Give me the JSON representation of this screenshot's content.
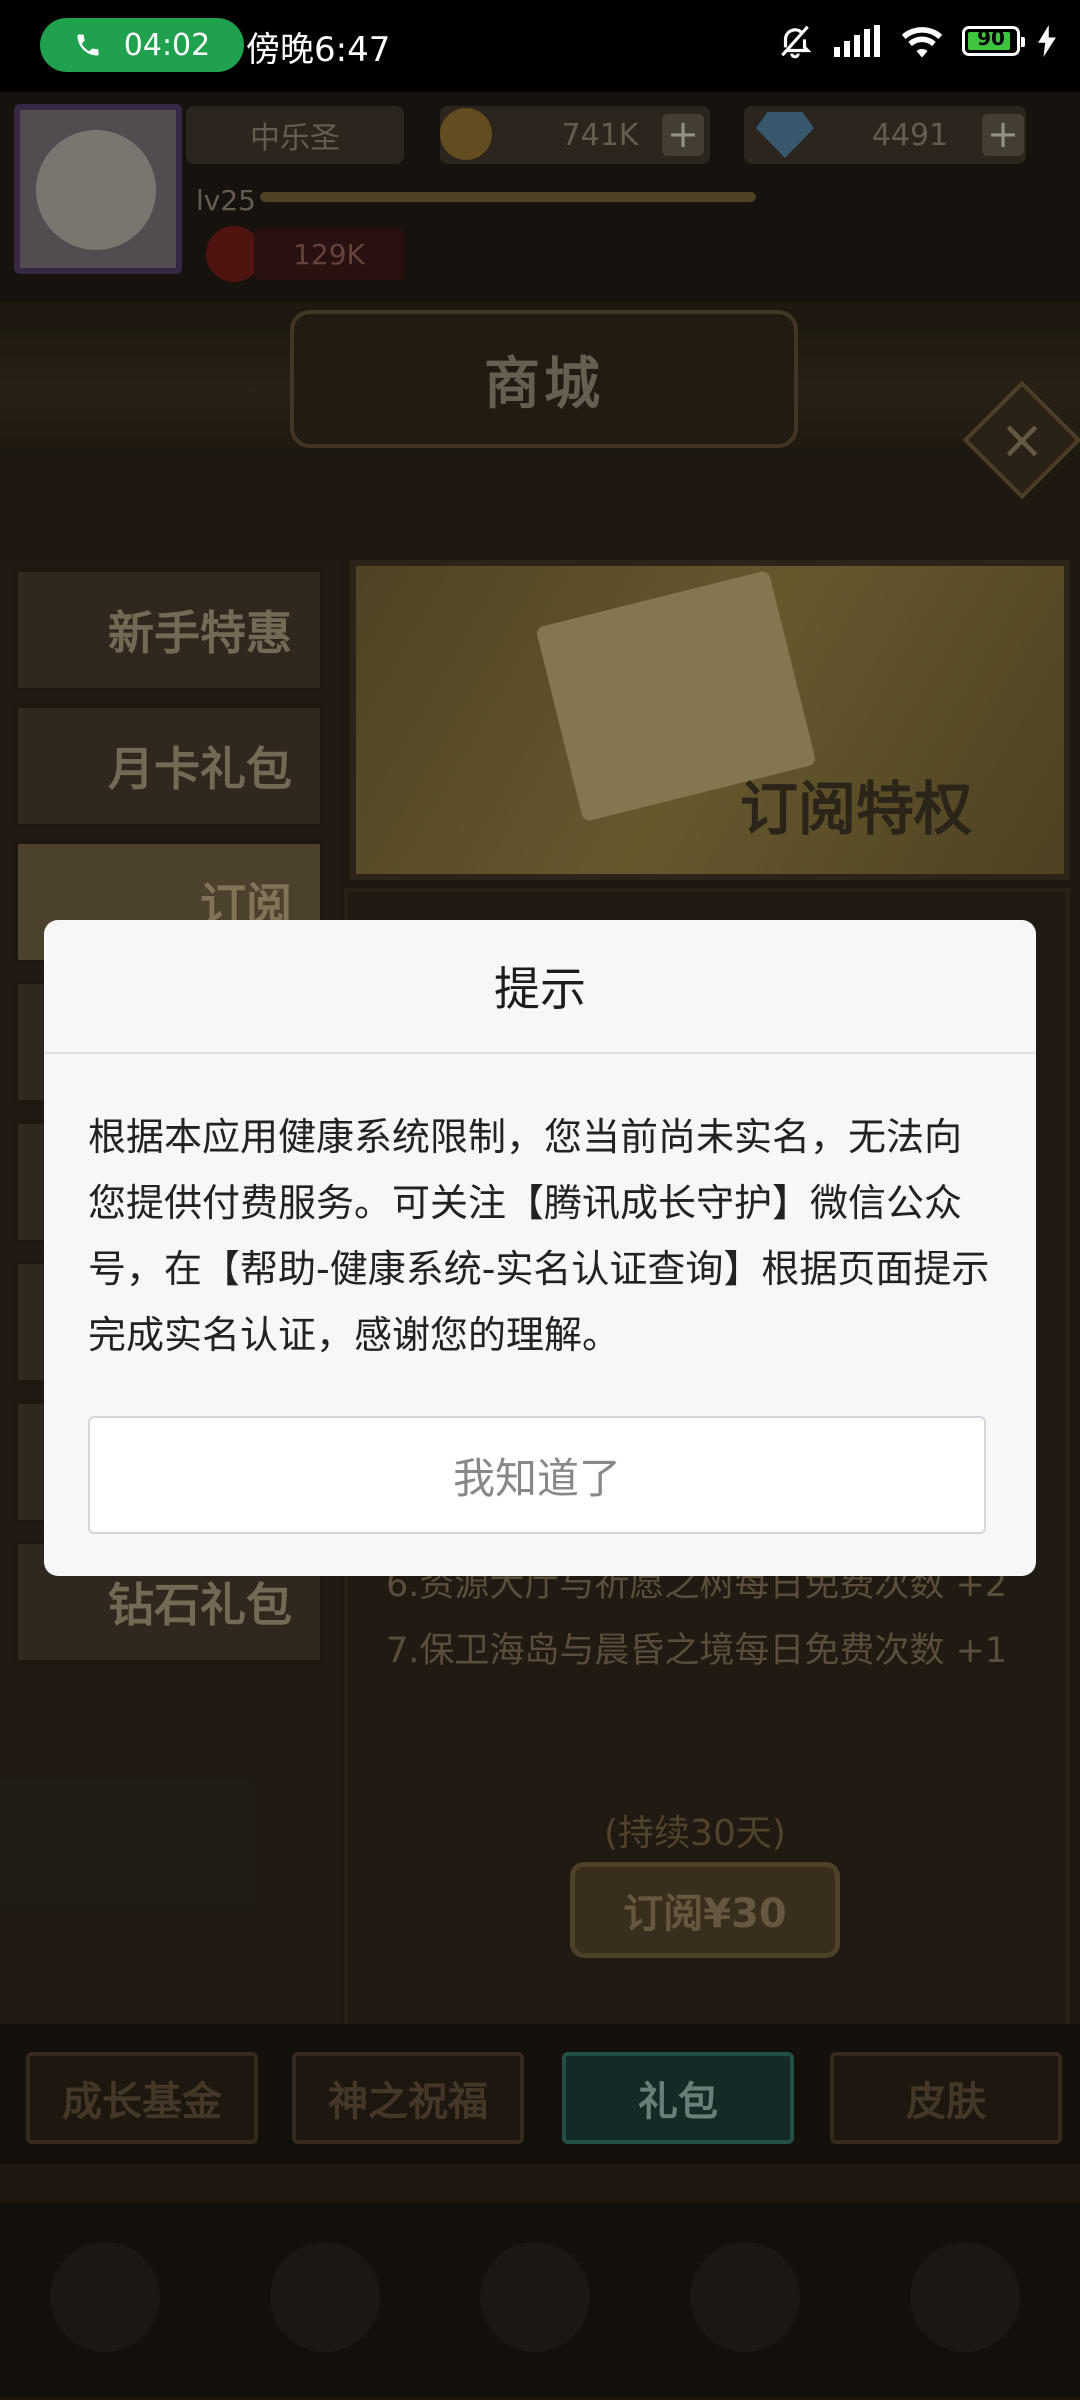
{
  "status_bar": {
    "call_timer": "04:02",
    "time": "傍晚6:47",
    "battery": "90"
  },
  "game": {
    "player_name": "中乐圣",
    "level": "lv25",
    "gold": "741K",
    "diamonds": "4491",
    "power": "129K",
    "shop_title": "商城",
    "left_tabs": [
      "新手特惠",
      "月卡礼包",
      "订阅",
      "钻石礼包"
    ],
    "promo_title": "订阅特权",
    "benefits": [
      "6.资源大厅与祈愿之树每日免费次数 +2",
      "7.保卫海岛与晨昏之境每日免费次数 +1"
    ],
    "duration": "(持续30天)",
    "subscribe_button": "订阅¥30",
    "bottom_tabs": [
      "成长基金",
      "神之祝福",
      "礼包",
      "皮肤"
    ]
  },
  "dialog": {
    "title": "提示",
    "message": "根据本应用健康系统限制，您当前尚未实名，无法向您提供付费服务。可关注【腾讯成长守护】微信公众号，在【帮助-健康系统-实名认证查询】根据页面提示完成实名认证，感谢您的理解。",
    "button": "我知道了"
  }
}
